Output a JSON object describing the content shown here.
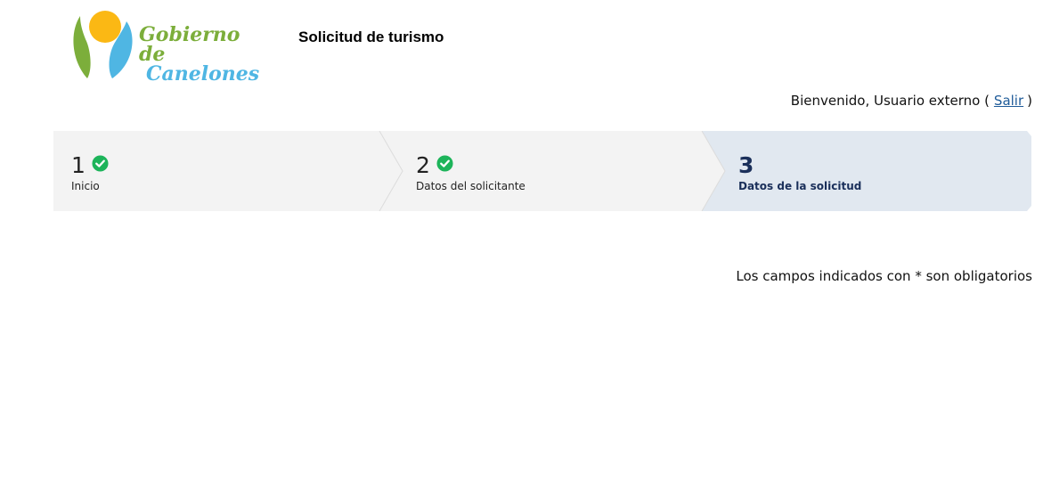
{
  "header": {
    "logo": {
      "line1": "Gobierno de",
      "line2": "Canelones",
      "colors": {
        "green": "#7cae3b",
        "blue": "#4fb6e3",
        "sun": "#fbb814"
      }
    },
    "title": "Solicitud de turismo"
  },
  "user": {
    "welcome": "Bienvenido, Usuario externo (",
    "logout": "Salir",
    "close": ")"
  },
  "stepper": {
    "steps": [
      {
        "number": "1",
        "label": "Inicio",
        "status": "complete",
        "icon": "check-circle-icon"
      },
      {
        "number": "2",
        "label": "Datos del solicitante",
        "status": "complete",
        "icon": "check-circle-icon"
      },
      {
        "number": "3",
        "label": "Datos de la solicitud",
        "status": "active"
      }
    ],
    "colors": {
      "inactive_bg": "#f3f3f3",
      "active_bg": "#e1e8f0",
      "check": "#1db45a",
      "active_text": "#1a2f5a"
    }
  },
  "form": {
    "required_note": "Los campos indicados con * son obligatorios"
  }
}
